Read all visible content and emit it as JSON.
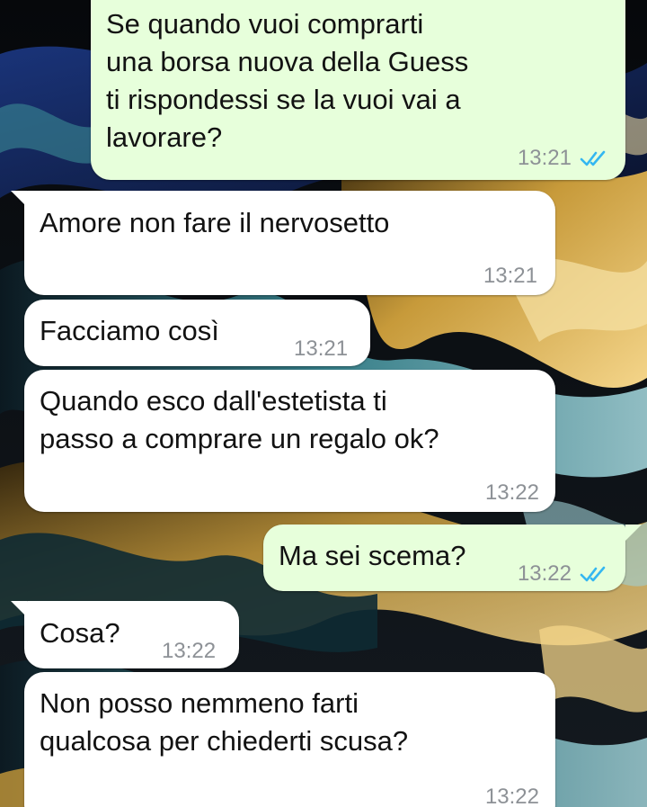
{
  "colors": {
    "outgoing_bubble": "#e7ffdb",
    "incoming_bubble": "#ffffff",
    "read_ticks": "#34b7f1",
    "timestamp": "#8d9196"
  },
  "messages": [
    {
      "direction": "outgoing",
      "text": "Se quando vuoi comprarti\nuna borsa nuova della Guess\nti rispondessi se la vuoi vai a\nlavorare?",
      "time": "13:21",
      "status_icon": "double-check-read-icon"
    },
    {
      "direction": "incoming",
      "text": "Amore non fare il nervosetto",
      "time": "13:21"
    },
    {
      "direction": "incoming",
      "text": "Facciamo così",
      "time": "13:21"
    },
    {
      "direction": "incoming",
      "text": "Quando esco dall'estetista ti\npasso a comprare un regalo ok?",
      "time": "13:22"
    },
    {
      "direction": "outgoing",
      "text": "Ma sei scema?",
      "time": "13:22",
      "status_icon": "double-check-read-icon"
    },
    {
      "direction": "incoming",
      "text": "Cosa?",
      "time": "13:22"
    },
    {
      "direction": "incoming",
      "text": "Non posso nemmeno farti\nqualcosa per chiederti scusa?",
      "time": "13:22"
    }
  ]
}
